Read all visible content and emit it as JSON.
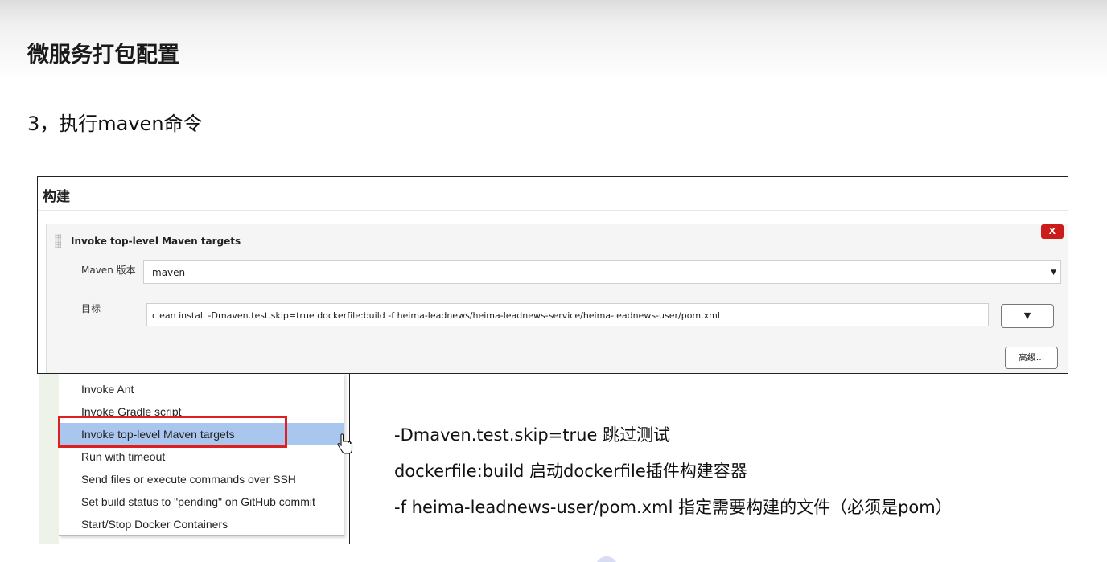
{
  "slide": {
    "title": "微服务打包配置",
    "step_heading": "3，执行maven命令"
  },
  "build_panel": {
    "header": "构建",
    "step": {
      "title": "Invoke top-level Maven targets",
      "delete_label": "X",
      "maven_version_label": "Maven 版本",
      "maven_version_value": "maven",
      "goals_label": "目标",
      "goals_value": "clean install -Dmaven.test.skip=true dockerfile:build -f heima-leadnews/heima-leadnews-service/heima-leadnews-user/pom.xml",
      "expand_label": "▼",
      "advanced_label": "高级..."
    }
  },
  "menu": {
    "items": [
      {
        "label": "Invoke Ant"
      },
      {
        "label": "Invoke Gradle script"
      },
      {
        "label": "Invoke top-level Maven targets"
      },
      {
        "label": "Run with timeout"
      },
      {
        "label": "Send files or execute commands over SSH"
      },
      {
        "label": "Set build status to \"pending\" on GitHub commit"
      },
      {
        "label": "Start/Stop Docker Containers"
      }
    ],
    "selected_index": 2,
    "highlight_color": "#e02020",
    "selected_color": "#a9c6ee"
  },
  "explanations": [
    "-Dmaven.test.skip=true   跳过测试",
    "dockerfile:build  启动dockerfile插件构建容器",
    "-f heima-leadnews-user/pom.xml  指定需要构建的文件（必须是pom）"
  ]
}
